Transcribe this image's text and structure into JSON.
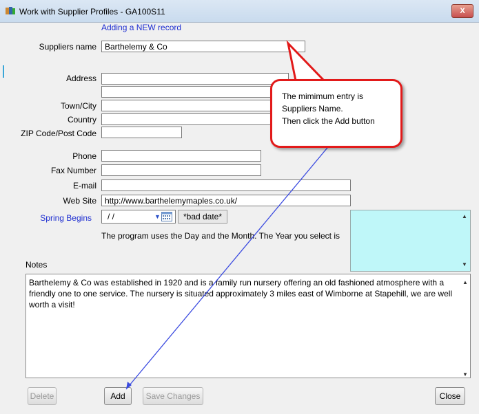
{
  "window": {
    "title": "Work with Supplier Profiles - GA100S11",
    "close_label": "X"
  },
  "mode_text": "Adding a NEW record",
  "labels": {
    "supplier_name": "Suppliers name",
    "address": "Address",
    "town": "Town/City",
    "country": "Country",
    "zip": "ZIP Code/Post Code",
    "phone": "Phone",
    "fax": "Fax Number",
    "email": "E-mail",
    "website": "Web Site",
    "spring": "Spring Begins",
    "notes": "Notes"
  },
  "values": {
    "supplier_name": "Barthelemy & Co",
    "address1": "",
    "address2": "",
    "town": "",
    "country": "",
    "zip": "",
    "phone": "",
    "fax": "",
    "email": "",
    "website": "http://www.barthelemymaples.co.uk/",
    "spring_date": " / /",
    "bad_date": "*bad date*"
  },
  "info_text": "The program uses the Day and the Month. The Year you select is",
  "notes_text": "Barthelemy & Co was established in 1920 and is a family run nursery offering an old fashioned atmosphere with a friendly one to one service. The nursery is situated approximately 3 miles east of Wimborne at Stapehill, we are well worth a visit!",
  "callout": {
    "line1": "The mimimum entry is",
    "line2": "Suppliers Name.",
    "line3": "Then click the Add button"
  },
  "buttons": {
    "delete": "Delete",
    "add": "Add",
    "save": "Save Changes",
    "close": "Close"
  },
  "colors": {
    "link": "#1f2fd1",
    "callout_border": "#e21a1a",
    "arrow": "#3b4be0",
    "panel": "#bff7f9"
  }
}
